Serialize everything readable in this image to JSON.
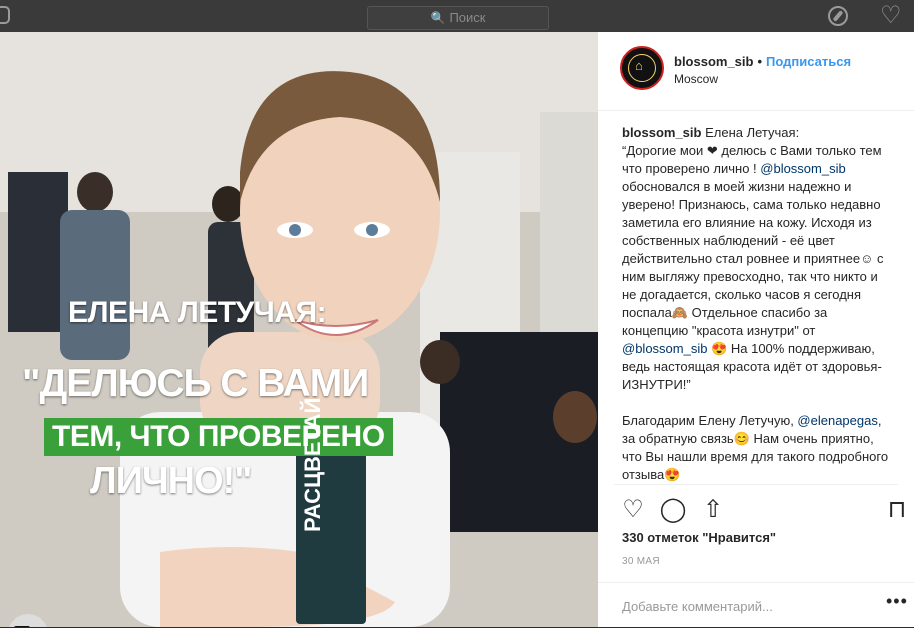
{
  "topbar": {
    "search_placeholder": "Поиск",
    "search_glyph": "🔍"
  },
  "post": {
    "overlay_line1": "ЕЛЕНА ЛЕТУЧАЯ:",
    "overlay_line2": "\"ДЕЛЮСЬ С ВАМИ",
    "overlay_line3": "ТЕМ, ЧТО ПРОВЕРЕНО",
    "overlay_line4": "ЛИЧНО!\"",
    "product_text": "РАСЦВЕТАЙ",
    "tagged_user": "elenapegas"
  },
  "header": {
    "username": "blossom_sib",
    "separator": "•",
    "follow_label": "Подписаться",
    "location": "Moscow"
  },
  "caption": {
    "author": "blossom_sib",
    "p1_intro": "Елена Летучая:",
    "p1_a": "“Дорогие мои ❤ делюсь с Вами только тем что проверено лично ! ",
    "p1_mention": "@blossom_sib",
    "p1_b": " обосновался в моей жизни надежно и уверено! Признаюсь, сама только недавно заметила его влияние на кожу. Исходя из собственных наблюдений - её цвет действительно стал ровнее и приятнее☺ с ним выгляжу превосходно, так что никто и не догадается, сколько часов я сегодня поспала🙈 Отдельное спасибо за концепцию \"красота изнутри\" от ",
    "p1_mention2": "@blossom_sib",
    "p1_c": " 😍 На 100% поддерживаю, ведь настоящая красота идёт от здоровья-ИЗНУТРИ!”",
    "p2_a": "Благодарим Елену Летучую, ",
    "p2_mention": "@elenapegas",
    "p2_b": ", за обратную связь😊 Нам очень приятно, что Вы нашли время для такого подробного отзыва😍"
  },
  "actions": {
    "like_icon": "♡",
    "comment_icon": "◯",
    "share_icon": "⇧",
    "save_icon": "⊓"
  },
  "likes_text": "330 отметок \"Нравится\"",
  "date_text": "30 МАЯ",
  "comment_placeholder": "Добавьте комментарий...",
  "more_label": "•••",
  "colors": {
    "accent": "#3897f0",
    "mention": "#003569",
    "green_banner": "#3aa13a"
  }
}
